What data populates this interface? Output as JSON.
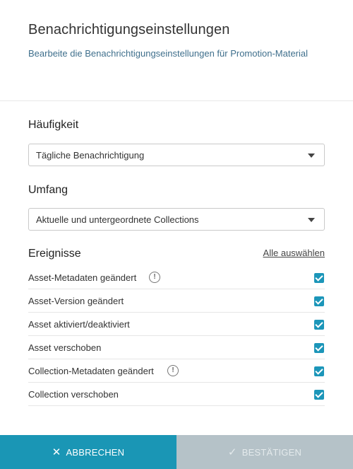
{
  "header": {
    "title": "Benachrichtigungseinstellungen",
    "subtitle": "Bearbeite die Benachrichtigungseinstellungen für Promotion-Material"
  },
  "frequency": {
    "label": "Häufigkeit",
    "selected": "Tägliche Benachrichtigung"
  },
  "scope": {
    "label": "Umfang",
    "selected": "Aktuelle und untergeordnete Collections"
  },
  "events": {
    "label": "Ereignisse",
    "select_all": "Alle auswählen",
    "items": [
      {
        "label": "Asset-Metadaten geändert",
        "info": true,
        "checked": true
      },
      {
        "label": "Asset-Version geändert",
        "info": false,
        "checked": true
      },
      {
        "label": "Asset aktiviert/deaktiviert",
        "info": false,
        "checked": true
      },
      {
        "label": "Asset verschoben",
        "info": false,
        "checked": true
      },
      {
        "label": "Collection-Metadaten geändert",
        "info": true,
        "checked": true
      },
      {
        "label": "Collection verschoben",
        "info": false,
        "checked": true
      }
    ]
  },
  "footer": {
    "cancel_label": "ABBRECHEN",
    "confirm_label": "BESTÄTIGEN",
    "confirm_enabled": false
  },
  "colors": {
    "accent": "#1a96b5",
    "checkbox": "#1c96b9",
    "disabled": "#b5c2c8",
    "subtitle": "#3f6f8c"
  },
  "icons": {
    "info": "info-circle-icon",
    "cancel": "close-icon",
    "confirm": "checkmark-icon",
    "dropdown": "caret-down-icon",
    "check": "checkbox-checked-icon"
  }
}
